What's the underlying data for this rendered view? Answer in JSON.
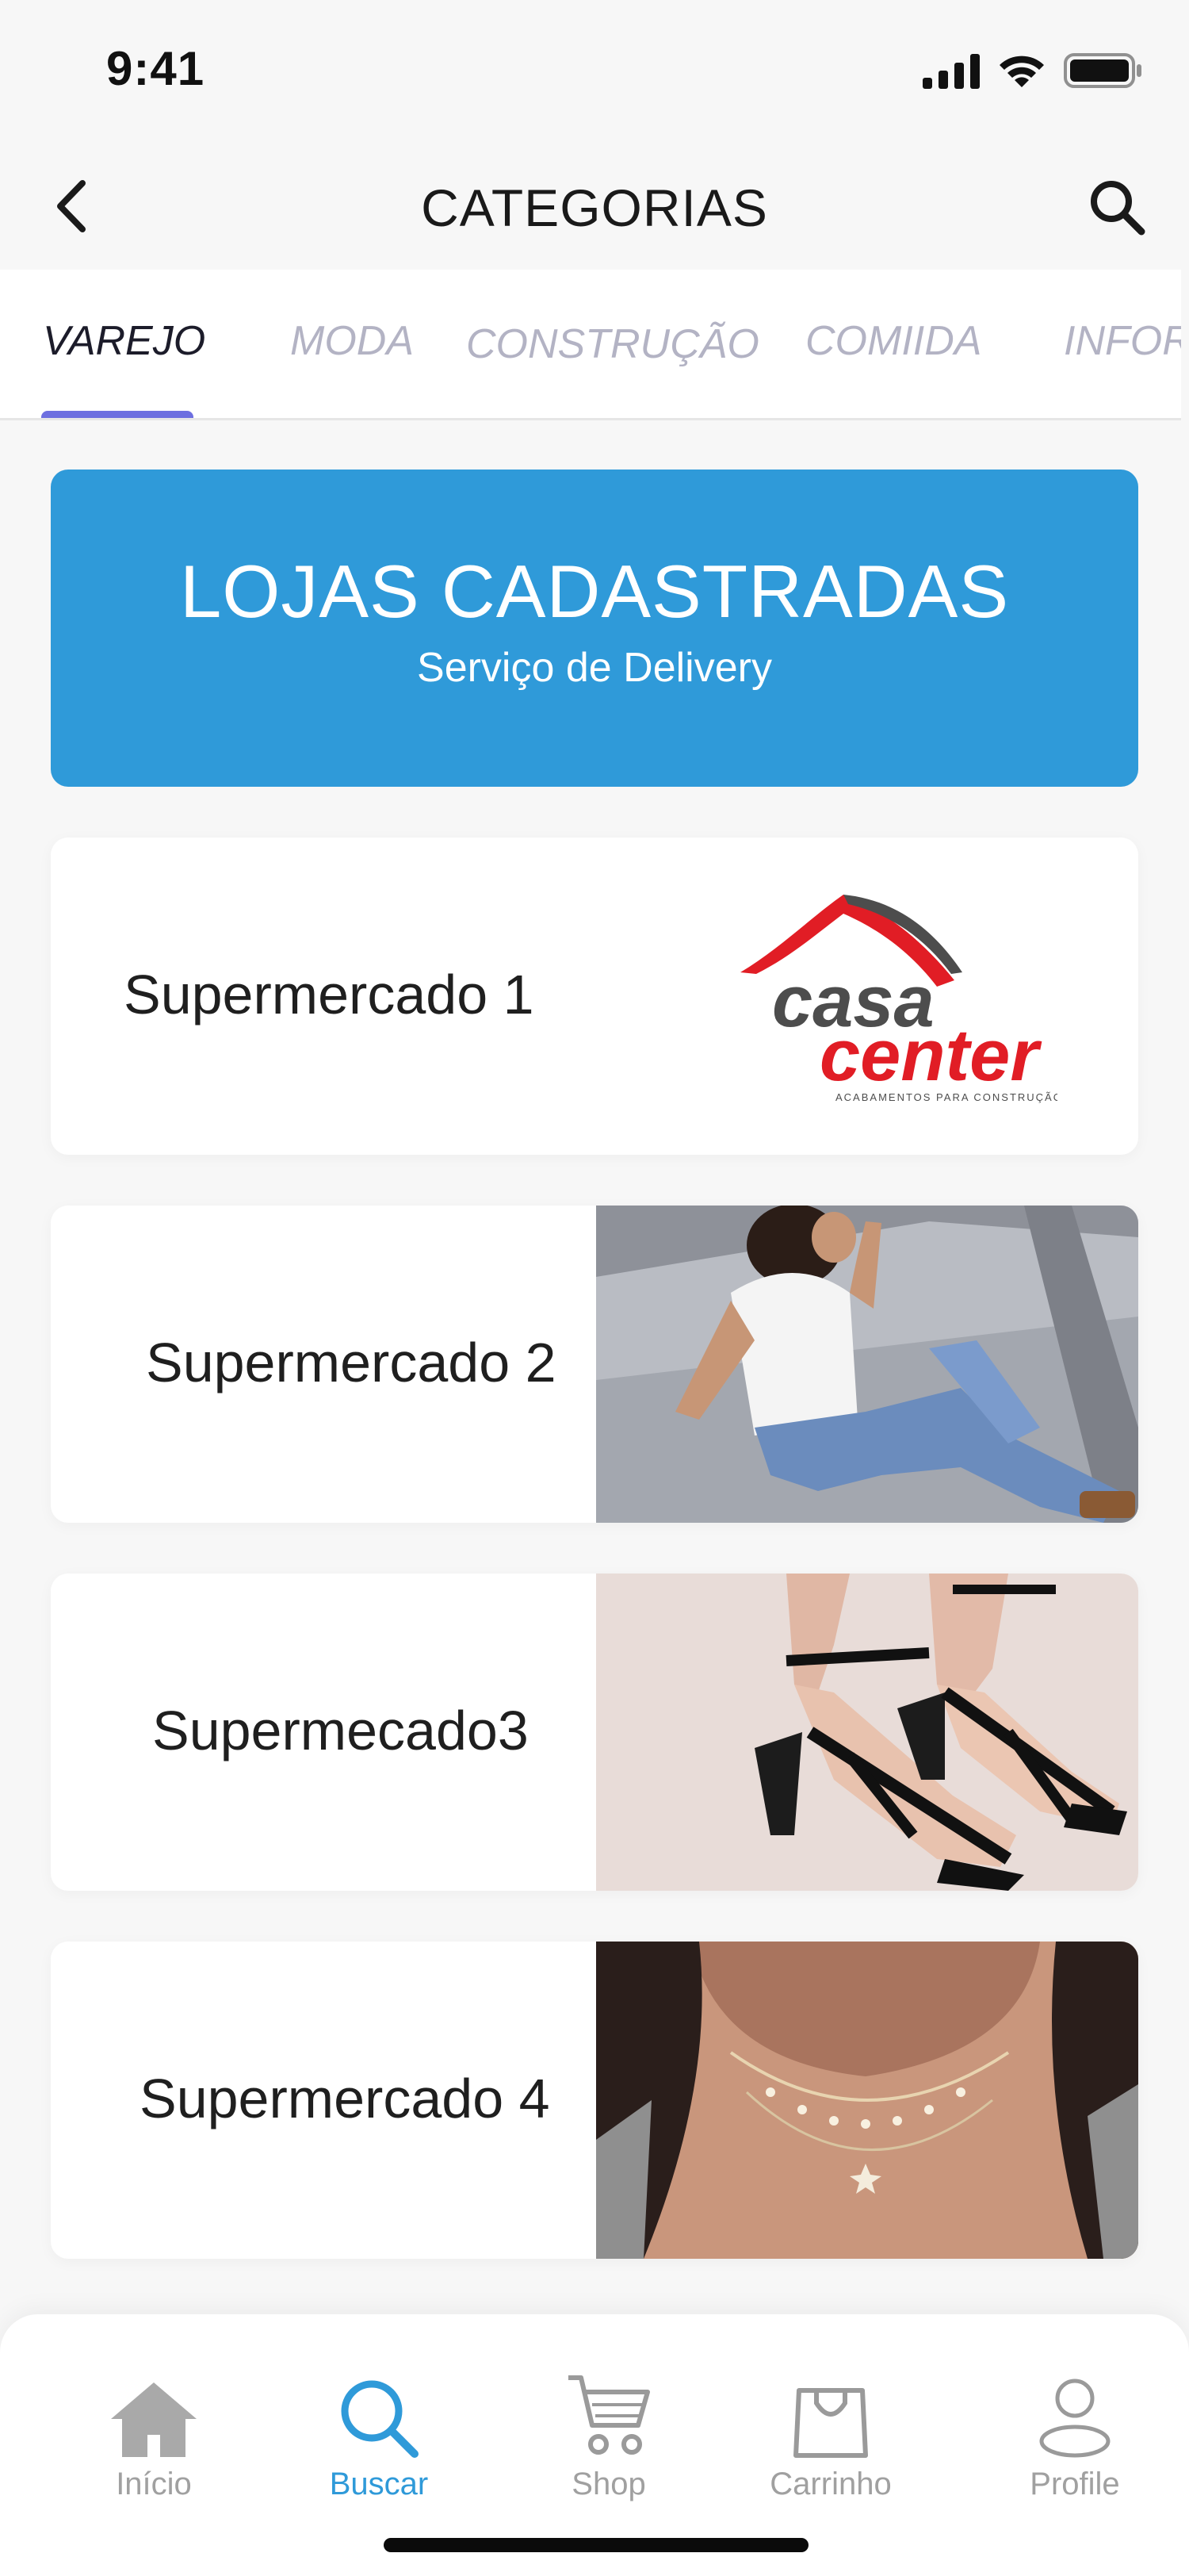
{
  "status_bar": {
    "time": "9:41"
  },
  "header": {
    "title": "CATEGORIAS"
  },
  "tabs": [
    {
      "label": "VAREJO",
      "active": true
    },
    {
      "label": "MODA",
      "active": false
    },
    {
      "label": "CONSTRUÇÃO",
      "active": false
    },
    {
      "label": "COMIIDA",
      "active": false
    },
    {
      "label": "INFOR",
      "active": false
    }
  ],
  "banner": {
    "title": "LOJAS CADASTRADAS",
    "subtitle": "Serviço de Delivery"
  },
  "stores": [
    {
      "name": "Supermercado 1",
      "image": "casa-center-logo",
      "logo": {
        "line1": "casa",
        "line2": "center",
        "tagline": "ACABAMENTOS PARA CONSTRUÇÃO"
      }
    },
    {
      "name": "Supermercado 2",
      "image": "woman-sitting-on-sidewalk-photo"
    },
    {
      "name": "Supermecado3",
      "image": "black-strappy-heels-photo"
    },
    {
      "name": "Supermercado 4",
      "image": "layered-necklace-photo"
    }
  ],
  "bottom_nav": [
    {
      "label": "Início",
      "icon": "home-icon",
      "active": false
    },
    {
      "label": "Buscar",
      "icon": "search-icon",
      "active": true
    },
    {
      "label": "Shop",
      "icon": "cart-icon",
      "active": false
    },
    {
      "label": "Carrinho",
      "icon": "bag-icon",
      "active": false
    },
    {
      "label": "Profile",
      "icon": "profile-icon",
      "active": false
    }
  ],
  "colors": {
    "accent": "#2f9ad9",
    "tab_indicator": "#6d6fe0",
    "logo_red": "#e11d25",
    "logo_gray": "#4d4d4d"
  }
}
